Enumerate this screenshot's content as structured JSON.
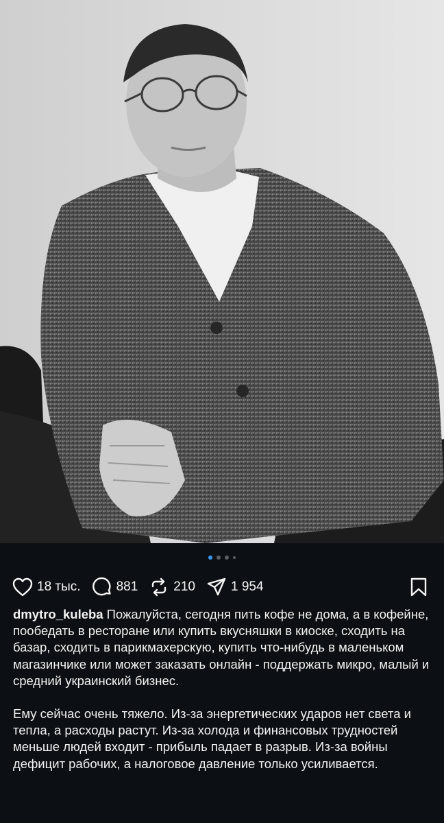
{
  "post": {
    "image_alt": "Black and white portrait of a man in glasses and knitted cardigan",
    "carousel": {
      "count": 4,
      "active": 1
    },
    "actions": {
      "likes": "18 тыс.",
      "comments": "881",
      "reposts": "210",
      "shares": "1 954"
    },
    "caption": {
      "username": "dmytro_kuleba",
      "paragraph1": "Пожалуйста, сегодня пить кофе не дома, а в кофейне, пообедать в ресторане или купить вкусняшки в киоске, сходить на базар, сходить в парикмахерскую, купить что-нибудь в маленьком магазинчике или может заказать онлайн - поддержать микро, малый и средний украинский бизнес.",
      "paragraph2": "Ему сейчас очень тяжело. Из-за энергетических ударов нет света и тепла, а расходы растут. Из-за холода и финансовых трудностей меньше людей входит - прибыль падает в разрыв. Из-за войны дефицит рабочих, а налоговое давление только усиливается."
    }
  },
  "icons": [
    "heart-icon",
    "comment-icon",
    "repost-icon",
    "share-icon",
    "bookmark-icon"
  ],
  "colors": {
    "background": "#0c1014",
    "accent": "#3797f0",
    "text": "#f5f5f5"
  }
}
